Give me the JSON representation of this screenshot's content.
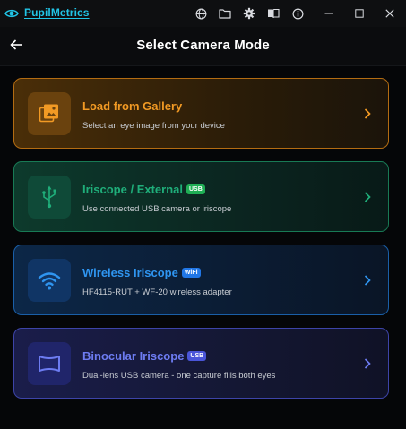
{
  "titlebar": {
    "app_name": "PupilMetrics",
    "logo_icon": "eye-icon",
    "icons": [
      "globe-icon",
      "folder-icon",
      "gear-icon",
      "book-icon",
      "info-icon"
    ],
    "window_controls": [
      "minimize-icon",
      "maximize-icon",
      "close-icon"
    ]
  },
  "header": {
    "title": "Select Camera Mode",
    "back_icon": "arrow-left-icon"
  },
  "cards": [
    {
      "title": "Load from Gallery",
      "badge": "",
      "description": "Select an eye image from your device",
      "icon": "gallery-image-icon",
      "accent": "#f29a24"
    },
    {
      "title": "Iriscope / External",
      "badge": "USB",
      "description": "Use connected USB camera or iriscope",
      "icon": "usb-icon",
      "accent": "#1fae7a"
    },
    {
      "title": "Wireless Iriscope",
      "badge": "WiFi",
      "description": "HF4115-RUT + WF-20 wireless adapter",
      "icon": "wifi-icon",
      "accent": "#2f95f0"
    },
    {
      "title": "Binocular Iriscope",
      "badge": "USB",
      "description": "Dual-lens USB camera - one capture fills both eyes",
      "icon": "panorama-icon",
      "accent": "#6d7cf2"
    }
  ]
}
